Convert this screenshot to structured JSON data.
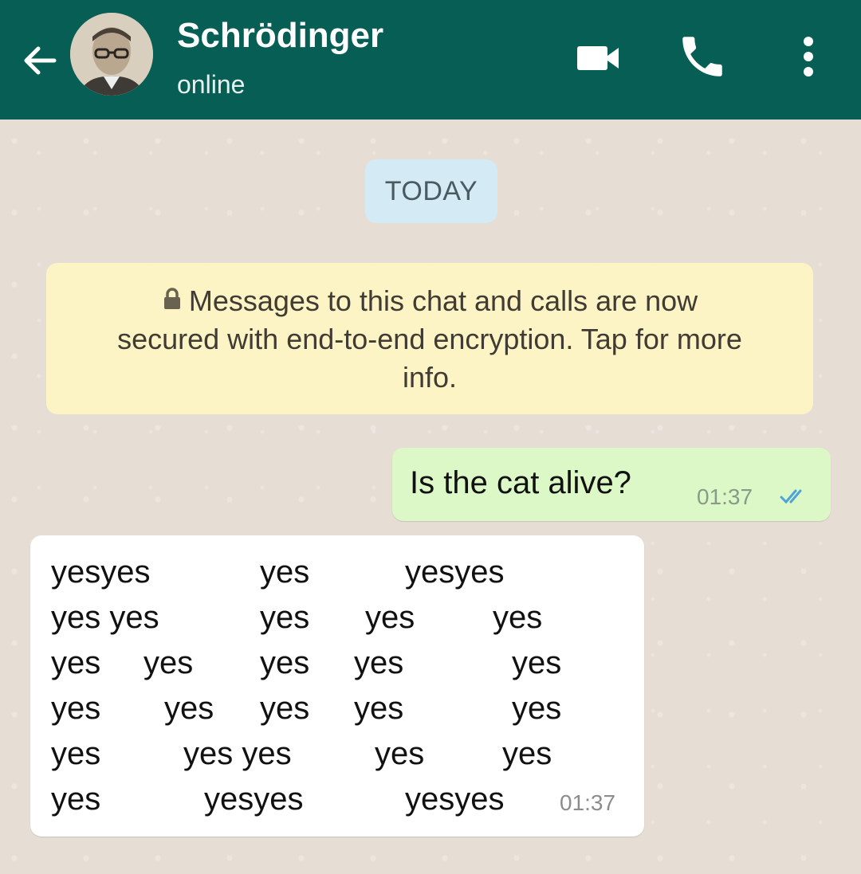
{
  "header": {
    "contact_name": "Schrödinger",
    "status": "online",
    "icons": [
      "back-arrow-icon",
      "avatar",
      "video-camera-icon",
      "phone-icon",
      "more-vertical-icon"
    ],
    "color": "#075e54"
  },
  "chat": {
    "date_chip": "TODAY",
    "notice": {
      "icon": "lock-icon",
      "line1": "Messages to this chat and calls are now",
      "line2": "secured with end-to-end encryption. Tap for more",
      "line3": "info."
    },
    "outgoing": {
      "text": "Is the cat alive?",
      "time": "01:37",
      "status_icon": "double-check-icon",
      "color": "#dcf8c6"
    },
    "incoming": {
      "rows": [
        [
          "yesyes",
          "yes",
          "yesyes"
        ],
        [
          "yes yes",
          "yes",
          "yes",
          "yes"
        ],
        [
          "yes",
          "yes",
          "yes",
          "yes",
          "yes"
        ],
        [
          "yes",
          "yes",
          "yes",
          "yes",
          "yes"
        ],
        [
          "yes",
          "yes yes",
          "yes",
          "yes"
        ],
        [
          "yes",
          "yesyes",
          "yesyes"
        ]
      ],
      "time": "01:37"
    }
  }
}
